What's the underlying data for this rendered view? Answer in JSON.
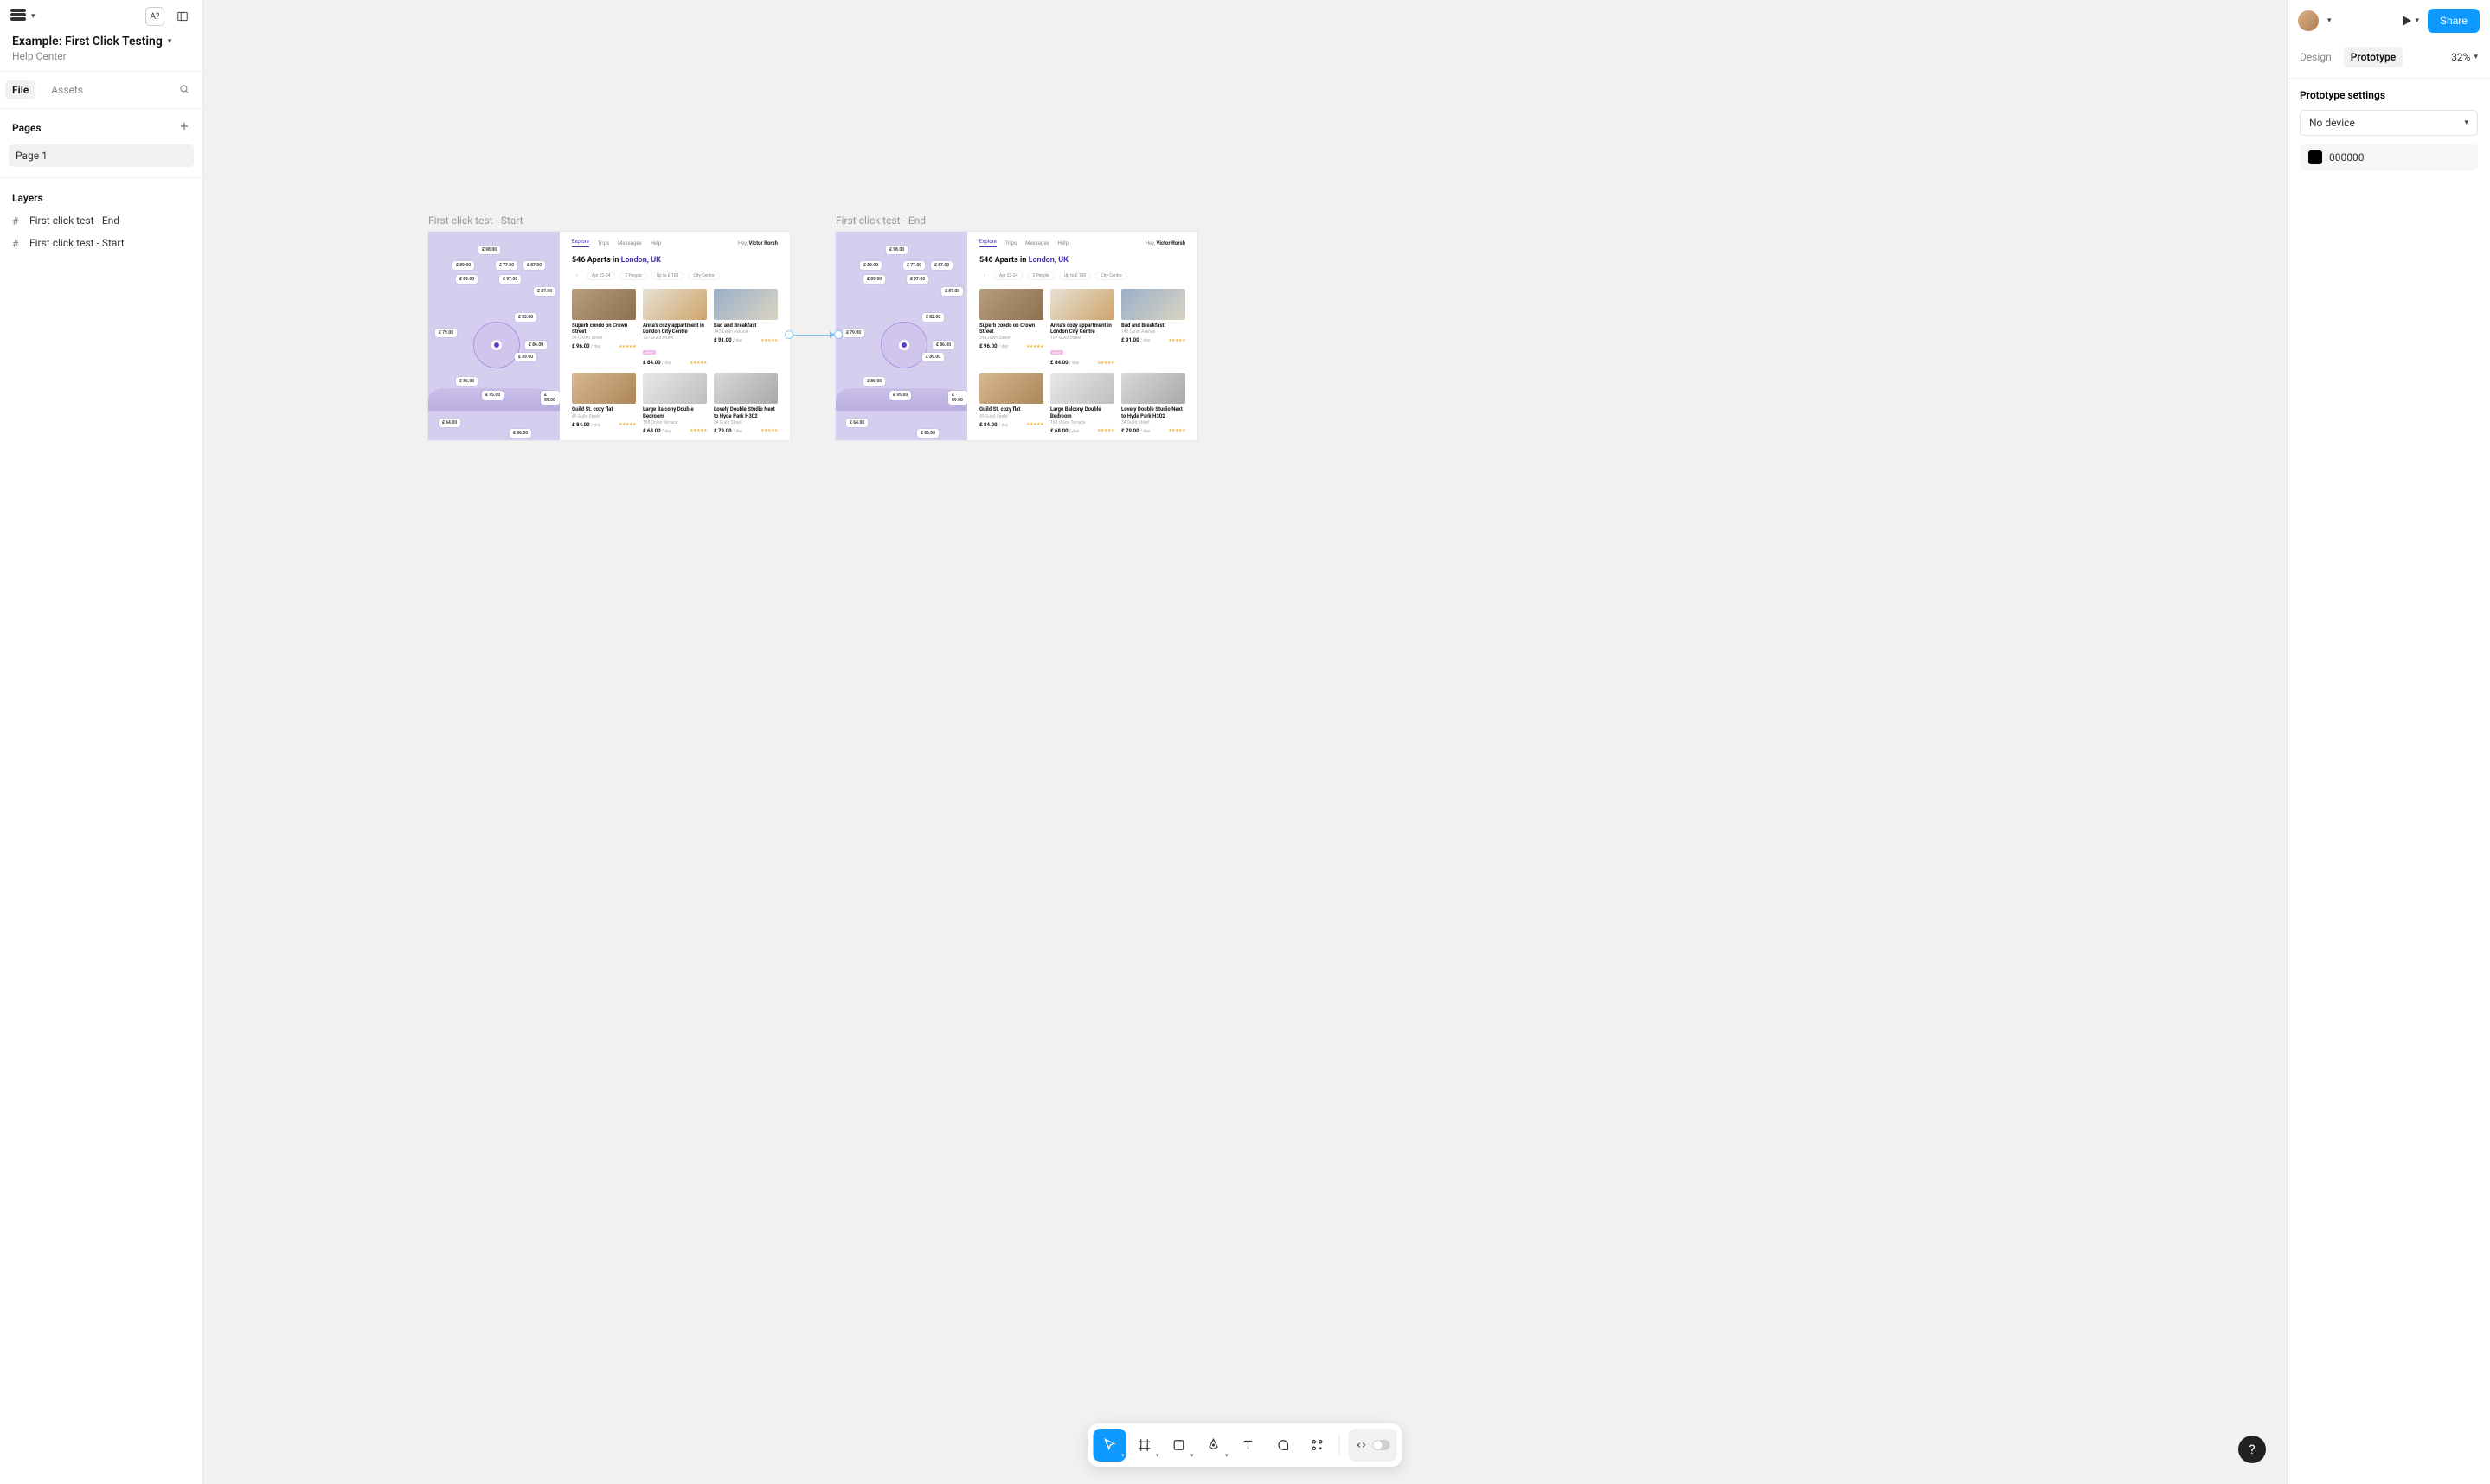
{
  "header": {
    "file_title": "Example: First Click Testing",
    "file_subtitle": "Help Center"
  },
  "left_tabs": {
    "file": "File",
    "assets": "Assets"
  },
  "pages": {
    "heading": "Pages",
    "items": [
      "Page 1"
    ]
  },
  "layers": {
    "heading": "Layers",
    "items": [
      "First click test - End",
      "First click test - Start"
    ]
  },
  "canvas": {
    "frames": [
      {
        "label": "First click test - Start"
      },
      {
        "label": "First click test - End"
      }
    ],
    "mock": {
      "nav": {
        "explore": "Explore",
        "trips": "Trips",
        "messages": "Messages",
        "help": "Help",
        "greeting_prefix": "Hey, ",
        "greeting_name": "Victor Rorsh"
      },
      "heading_prefix": "546 Aparts in ",
      "heading_loc": "London, UK",
      "filters": [
        "Apr 22-24",
        "2 People",
        "Up to £ 100",
        "City Centre"
      ],
      "map_prices": [
        "£ 98.00",
        "£ 89.00",
        "£ 77.00",
        "£ 87.00",
        "£ 89.00",
        "£ 97.00",
        "£ 87.00",
        "£ 82.00",
        "£ 79.00",
        "£ 86.00",
        "£ 89.00",
        "£ 86.00",
        "£ 95.00",
        "£ 89.00",
        "£ 64.00",
        "£ 86.00"
      ],
      "cards": [
        {
          "title": "Superb condo on Crown Street",
          "sub": "24 Crown Street",
          "price": "£ 96.00",
          "per": "/ day",
          "new": false
        },
        {
          "title": "Anna's cozy appartment in London City Centre",
          "sub": "107 Guild Street",
          "price": "£ 84.00",
          "per": "/ day",
          "new": true
        },
        {
          "title": "Bad and Breakfast",
          "sub": "142 Lenin Avenue",
          "price": "£ 91.00",
          "per": "/ day",
          "new": false
        },
        {
          "title": "Guild St. cozy flat",
          "sub": "69 Guild Street",
          "price": "£ 84.00",
          "per": "/ day",
          "new": false
        },
        {
          "title": "Large Balcony Double Bedroom",
          "sub": "168 Union Terrace",
          "price": "£ 68.00",
          "per": "/ day",
          "new": false
        },
        {
          "title": "Lovely Double Studio Next to Hyde Park H302",
          "sub": "34 Guild Street",
          "price": "£ 79.00",
          "per": "/ day",
          "new": false
        }
      ]
    }
  },
  "right": {
    "share": "Share",
    "tabs": {
      "design": "Design",
      "prototype": "Prototype"
    },
    "zoom": "32%",
    "section_title": "Prototype settings",
    "device_select": "No device",
    "bg_hex": "000000"
  }
}
